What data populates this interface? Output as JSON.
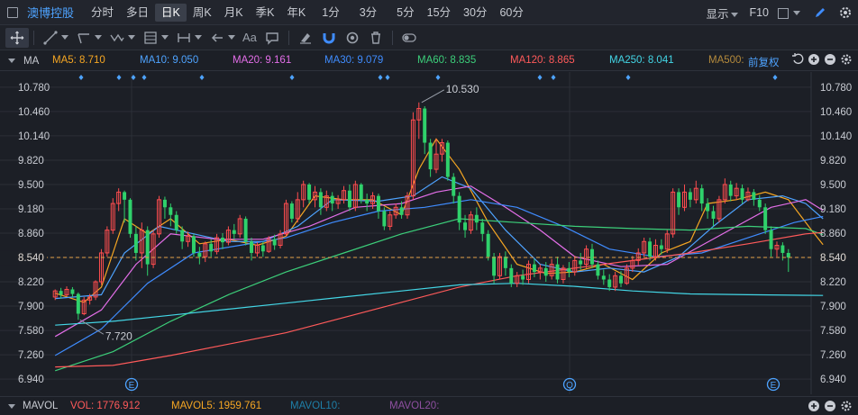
{
  "header": {
    "stock_name": "澳博控股",
    "periods": [
      "分时",
      "多日",
      "日K",
      "周K",
      "月K",
      "季K",
      "年K",
      "1分",
      "3分",
      "5分",
      "15分",
      "30分",
      "60分"
    ],
    "active_period": "日K",
    "display_label": "显示",
    "f10_label": "F10"
  },
  "toolbar": {
    "text_tool_label": "Aa"
  },
  "ma_line": {
    "title": "MA",
    "items": [
      {
        "label": "MA5: 8.710",
        "color": "#f5a623"
      },
      {
        "label": "MA10: 9.050",
        "color": "#4ea3ff"
      },
      {
        "label": "MA20: 9.161",
        "color": "#e36ee8"
      },
      {
        "label": "MA30: 9.079",
        "color": "#3f8cff"
      },
      {
        "label": "MA60: 8.835",
        "color": "#3ccf7a"
      },
      {
        "label": "MA120: 8.865",
        "color": "#ff5a5a"
      },
      {
        "label": "MA250: 8.041",
        "color": "#43d6e6"
      },
      {
        "label": "MA500:",
        "color": "#b48a3c"
      }
    ],
    "adjust_label": "前复权"
  },
  "volume_line": {
    "title": "MAVOL",
    "items": [
      {
        "label": "VOL: 1776.912",
        "color": "#ff5a5a"
      },
      {
        "label": "MAVOL5: 1959.761",
        "color": "#f5a623"
      },
      {
        "label": "MAVOL10:",
        "color": "#1e7fa8"
      },
      {
        "label": "MAVOL20:",
        "color": "#8e4fa0"
      }
    ]
  },
  "chart_data": {
    "type": "candlestick",
    "y_ticks": [
      "10.780",
      "10.460",
      "10.140",
      "9.820",
      "9.500",
      "9.180",
      "8.860",
      "8.540",
      "8.220",
      "7.900",
      "7.580",
      "7.260",
      "6.940"
    ],
    "y_range": [
      6.74,
      10.98
    ],
    "current_price": "8.540",
    "high_label": "10.530",
    "low_label": "7.720",
    "event_markers": [
      "E",
      "Q",
      "E"
    ],
    "colors": {
      "up": "#ff4d4f",
      "down": "#2fd16b",
      "grid": "#2b2f37",
      "axis_text": "#c9ccd3",
      "price_line": "#e3a04b"
    },
    "candles": [
      [
        8.02,
        8.1,
        8.12,
        7.98
      ],
      [
        8.1,
        8.05,
        8.14,
        8.0
      ],
      [
        8.05,
        8.12,
        8.16,
        8.03
      ],
      [
        8.12,
        8.06,
        8.15,
        8.02
      ],
      [
        8.06,
        7.8,
        8.08,
        7.72
      ],
      [
        7.8,
        7.98,
        8.02,
        7.78
      ],
      [
        7.98,
        8.02,
        8.06,
        7.92
      ],
      [
        8.02,
        8.22,
        8.24,
        7.98
      ],
      [
        8.22,
        8.6,
        8.65,
        8.18
      ],
      [
        8.6,
        8.9,
        8.95,
        8.55
      ],
      [
        8.9,
        9.25,
        9.32,
        8.85
      ],
      [
        9.25,
        9.4,
        9.45,
        9.15
      ],
      [
        9.4,
        9.3,
        9.42,
        9.0
      ],
      [
        9.3,
        8.85,
        9.32,
        8.8
      ],
      [
        8.85,
        8.6,
        8.95,
        8.5
      ],
      [
        8.6,
        8.9,
        9.0,
        8.4
      ],
      [
        8.9,
        8.45,
        8.95,
        8.3
      ],
      [
        8.45,
        8.85,
        8.9,
        8.4
      ],
      [
        8.85,
        9.3,
        9.35,
        8.8
      ],
      [
        9.3,
        9.2,
        9.34,
        9.05
      ],
      [
        9.2,
        9.1,
        9.25,
        8.95
      ],
      [
        9.1,
        8.9,
        9.15,
        8.85
      ],
      [
        8.9,
        8.75,
        8.95,
        8.65
      ],
      [
        8.75,
        8.82,
        8.88,
        8.68
      ],
      [
        8.82,
        8.6,
        8.85,
        8.55
      ],
      [
        8.6,
        8.55,
        8.68,
        8.45
      ],
      [
        8.55,
        8.72,
        8.75,
        8.48
      ],
      [
        8.72,
        8.62,
        8.78,
        8.55
      ],
      [
        8.62,
        8.8,
        8.85,
        8.58
      ],
      [
        8.8,
        8.74,
        8.86,
        8.65
      ],
      [
        8.74,
        8.9,
        8.95,
        8.7
      ],
      [
        8.9,
        8.85,
        8.98,
        8.78
      ],
      [
        8.85,
        9.05,
        9.1,
        8.8
      ],
      [
        9.05,
        8.75,
        9.08,
        8.7
      ],
      [
        8.75,
        8.6,
        8.8,
        8.5
      ],
      [
        8.6,
        8.7,
        8.74,
        8.55
      ],
      [
        8.7,
        8.62,
        8.75,
        8.55
      ],
      [
        8.62,
        8.78,
        8.82,
        8.6
      ],
      [
        8.78,
        8.7,
        8.84,
        8.64
      ],
      [
        8.7,
        8.85,
        8.9,
        8.66
      ],
      [
        8.85,
        9.25,
        9.3,
        8.82
      ],
      [
        9.25,
        9.05,
        9.28,
        9.0
      ],
      [
        9.05,
        9.3,
        9.4,
        9.0
      ],
      [
        9.3,
        9.5,
        9.55,
        9.2
      ],
      [
        9.5,
        9.3,
        9.52,
        9.25
      ],
      [
        9.3,
        9.4,
        9.48,
        9.2
      ],
      [
        9.4,
        9.2,
        9.45,
        9.1
      ],
      [
        9.2,
        9.35,
        9.42,
        9.15
      ],
      [
        9.35,
        9.25,
        9.4,
        9.15
      ],
      [
        9.25,
        9.3,
        9.36,
        9.18
      ],
      [
        9.3,
        9.42,
        9.48,
        9.25
      ],
      [
        9.42,
        9.2,
        9.5,
        9.15
      ],
      [
        9.2,
        9.5,
        9.55,
        9.15
      ],
      [
        9.5,
        9.3,
        9.52,
        9.25
      ],
      [
        9.3,
        9.25,
        9.38,
        9.15
      ],
      [
        9.25,
        9.35,
        9.4,
        9.18
      ],
      [
        9.35,
        9.15,
        9.38,
        9.05
      ],
      [
        9.15,
        8.95,
        9.2,
        8.9
      ],
      [
        8.95,
        9.1,
        9.15,
        8.9
      ],
      [
        9.1,
        9.2,
        9.25,
        9.05
      ],
      [
        9.2,
        9.1,
        9.28,
        9.05
      ],
      [
        9.1,
        9.35,
        9.4,
        9.05
      ],
      [
        9.35,
        10.35,
        10.45,
        9.3
      ],
      [
        10.35,
        10.5,
        10.58,
        10.1
      ],
      [
        10.5,
        10.05,
        10.53,
        9.9
      ],
      [
        10.05,
        9.7,
        10.1,
        9.6
      ],
      [
        9.7,
        9.9,
        10.1,
        9.65
      ],
      [
        9.9,
        10.05,
        10.1,
        9.8
      ],
      [
        10.05,
        9.6,
        10.08,
        9.55
      ],
      [
        9.6,
        9.35,
        9.65,
        9.25
      ],
      [
        9.35,
        9.0,
        9.4,
        8.9
      ],
      [
        9.0,
        8.9,
        9.1,
        8.8
      ],
      [
        8.9,
        9.1,
        9.15,
        8.85
      ],
      [
        9.1,
        9.0,
        9.2,
        8.9
      ],
      [
        9.0,
        8.85,
        9.05,
        8.75
      ],
      [
        8.85,
        8.55,
        8.9,
        8.5
      ],
      [
        8.55,
        8.3,
        8.6,
        8.2
      ],
      [
        8.3,
        8.55,
        8.6,
        8.25
      ],
      [
        8.55,
        8.4,
        8.62,
        8.3
      ],
      [
        8.4,
        8.2,
        8.45,
        8.15
      ],
      [
        8.2,
        8.3,
        8.35,
        8.15
      ],
      [
        8.3,
        8.25,
        8.38,
        8.18
      ],
      [
        8.25,
        8.45,
        8.5,
        8.2
      ],
      [
        8.45,
        8.35,
        8.52,
        8.28
      ],
      [
        8.35,
        8.4,
        8.45,
        8.25
      ],
      [
        8.4,
        8.3,
        8.48,
        8.22
      ],
      [
        8.3,
        8.45,
        8.52,
        8.25
      ],
      [
        8.45,
        8.25,
        8.55,
        8.2
      ],
      [
        8.25,
        8.4,
        8.44,
        8.2
      ],
      [
        8.4,
        8.35,
        8.48,
        8.28
      ],
      [
        8.35,
        8.5,
        8.56,
        8.3
      ],
      [
        8.5,
        8.45,
        8.6,
        8.38
      ],
      [
        8.45,
        8.65,
        8.7,
        8.4
      ],
      [
        8.65,
        8.45,
        8.72,
        8.4
      ],
      [
        8.45,
        8.3,
        8.5,
        8.25
      ],
      [
        8.3,
        8.25,
        8.38,
        8.18
      ],
      [
        8.25,
        8.15,
        8.32,
        8.1
      ],
      [
        8.15,
        8.3,
        8.35,
        8.1
      ],
      [
        8.3,
        8.2,
        8.36,
        8.15
      ],
      [
        8.2,
        8.4,
        8.45,
        8.18
      ],
      [
        8.4,
        8.5,
        8.56,
        8.35
      ],
      [
        8.5,
        8.6,
        8.66,
        8.44
      ],
      [
        8.6,
        8.75,
        8.8,
        8.55
      ],
      [
        8.75,
        8.55,
        8.8,
        8.5
      ],
      [
        8.55,
        8.7,
        8.78,
        8.5
      ],
      [
        8.7,
        8.65,
        8.78,
        8.58
      ],
      [
        8.65,
        8.85,
        8.9,
        8.6
      ],
      [
        8.85,
        9.4,
        9.45,
        8.8
      ],
      [
        9.4,
        9.2,
        9.45,
        9.1
      ],
      [
        9.2,
        9.4,
        9.5,
        9.15
      ],
      [
        9.4,
        9.3,
        9.45,
        9.2
      ],
      [
        9.3,
        9.45,
        9.55,
        9.25
      ],
      [
        9.45,
        9.25,
        9.5,
        9.15
      ],
      [
        9.25,
        9.15,
        9.32,
        9.05
      ],
      [
        9.15,
        9.05,
        9.22,
        8.95
      ],
      [
        9.05,
        9.3,
        9.35,
        9.0
      ],
      [
        9.3,
        9.5,
        9.58,
        9.25
      ],
      [
        9.5,
        9.35,
        9.55,
        9.28
      ],
      [
        9.35,
        9.45,
        9.52,
        9.3
      ],
      [
        9.45,
        9.3,
        9.5,
        9.25
      ],
      [
        9.3,
        9.4,
        9.46,
        9.28
      ],
      [
        9.4,
        9.3,
        9.44,
        9.22
      ],
      [
        9.3,
        9.2,
        9.36,
        9.15
      ],
      [
        9.2,
        8.9,
        9.25,
        8.85
      ],
      [
        8.9,
        8.65,
        8.95,
        8.55
      ],
      [
        8.65,
        8.7,
        8.75,
        8.55
      ],
      [
        8.7,
        8.6,
        8.74,
        8.5
      ],
      [
        8.6,
        8.54,
        8.65,
        8.35
      ]
    ],
    "ma_series": [
      {
        "color": "#f5a623",
        "points": [
          [
            0,
            8.07
          ],
          [
            5,
            7.95
          ],
          [
            8,
            8.15
          ],
          [
            12,
            9.05
          ],
          [
            16,
            8.85
          ],
          [
            20,
            9.05
          ],
          [
            25,
            8.72
          ],
          [
            30,
            8.78
          ],
          [
            35,
            8.7
          ],
          [
            40,
            8.82
          ],
          [
            45,
            9.35
          ],
          [
            50,
            9.3
          ],
          [
            55,
            9.3
          ],
          [
            60,
            9.1
          ],
          [
            63,
            9.7
          ],
          [
            66,
            10.1
          ],
          [
            70,
            9.7
          ],
          [
            75,
            9.0
          ],
          [
            80,
            8.45
          ],
          [
            85,
            8.33
          ],
          [
            90,
            8.35
          ],
          [
            95,
            8.45
          ],
          [
            100,
            8.25
          ],
          [
            105,
            8.6
          ],
          [
            110,
            8.75
          ],
          [
            113,
            9.25
          ],
          [
            118,
            9.3
          ],
          [
            123,
            9.4
          ],
          [
            127,
            9.3
          ],
          [
            131,
            8.9
          ],
          [
            133,
            8.71
          ]
        ]
      },
      {
        "color": "#4ea3ff",
        "points": [
          [
            0,
            8.0
          ],
          [
            8,
            8.05
          ],
          [
            12,
            8.6
          ],
          [
            18,
            8.95
          ],
          [
            24,
            8.85
          ],
          [
            30,
            8.75
          ],
          [
            36,
            8.75
          ],
          [
            42,
            8.95
          ],
          [
            48,
            9.3
          ],
          [
            56,
            9.28
          ],
          [
            62,
            9.35
          ],
          [
            67,
            9.6
          ],
          [
            72,
            9.45
          ],
          [
            78,
            8.9
          ],
          [
            84,
            8.45
          ],
          [
            90,
            8.35
          ],
          [
            96,
            8.4
          ],
          [
            102,
            8.35
          ],
          [
            108,
            8.55
          ],
          [
            114,
            8.95
          ],
          [
            120,
            9.3
          ],
          [
            126,
            9.35
          ],
          [
            130,
            9.25
          ],
          [
            133,
            9.05
          ]
        ]
      },
      {
        "color": "#e36ee8",
        "points": [
          [
            0,
            7.5
          ],
          [
            8,
            7.85
          ],
          [
            14,
            8.45
          ],
          [
            20,
            8.85
          ],
          [
            28,
            8.78
          ],
          [
            36,
            8.78
          ],
          [
            44,
            8.95
          ],
          [
            52,
            9.2
          ],
          [
            60,
            9.25
          ],
          [
            66,
            9.4
          ],
          [
            72,
            9.48
          ],
          [
            78,
            9.2
          ],
          [
            84,
            8.9
          ],
          [
            90,
            8.55
          ],
          [
            98,
            8.42
          ],
          [
            106,
            8.45
          ],
          [
            112,
            8.7
          ],
          [
            118,
            8.95
          ],
          [
            124,
            9.2
          ],
          [
            130,
            9.3
          ],
          [
            133,
            9.16
          ]
        ]
      },
      {
        "color": "#3f8cff",
        "points": [
          [
            0,
            7.25
          ],
          [
            8,
            7.6
          ],
          [
            16,
            8.2
          ],
          [
            24,
            8.6
          ],
          [
            32,
            8.7
          ],
          [
            40,
            8.8
          ],
          [
            48,
            9.0
          ],
          [
            56,
            9.15
          ],
          [
            64,
            9.2
          ],
          [
            72,
            9.3
          ],
          [
            80,
            9.2
          ],
          [
            88,
            8.95
          ],
          [
            96,
            8.65
          ],
          [
            104,
            8.55
          ],
          [
            112,
            8.6
          ],
          [
            120,
            8.8
          ],
          [
            128,
            9.0
          ],
          [
            133,
            9.08
          ]
        ]
      },
      {
        "color": "#3ccf7a",
        "points": [
          [
            0,
            7.05
          ],
          [
            10,
            7.3
          ],
          [
            20,
            7.7
          ],
          [
            30,
            8.05
          ],
          [
            40,
            8.35
          ],
          [
            50,
            8.6
          ],
          [
            60,
            8.85
          ],
          [
            70,
            9.05
          ],
          [
            80,
            9.0
          ],
          [
            90,
            8.95
          ],
          [
            100,
            8.92
          ],
          [
            110,
            8.9
          ],
          [
            120,
            8.95
          ],
          [
            130,
            8.92
          ],
          [
            133,
            8.84
          ]
        ]
      },
      {
        "color": "#ff5a5a",
        "points": [
          [
            0,
            7.1
          ],
          [
            10,
            7.12
          ],
          [
            20,
            7.25
          ],
          [
            30,
            7.4
          ],
          [
            40,
            7.55
          ],
          [
            50,
            7.75
          ],
          [
            60,
            7.95
          ],
          [
            70,
            8.15
          ],
          [
            80,
            8.3
          ],
          [
            90,
            8.4
          ],
          [
            100,
            8.5
          ],
          [
            110,
            8.6
          ],
          [
            120,
            8.72
          ],
          [
            130,
            8.85
          ],
          [
            133,
            8.87
          ]
        ]
      },
      {
        "color": "#43d6e6",
        "points": [
          [
            0,
            7.65
          ],
          [
            10,
            7.7
          ],
          [
            20,
            7.78
          ],
          [
            30,
            7.86
          ],
          [
            40,
            7.94
          ],
          [
            50,
            8.02
          ],
          [
            60,
            8.1
          ],
          [
            70,
            8.18
          ],
          [
            80,
            8.2
          ],
          [
            90,
            8.16
          ],
          [
            100,
            8.1
          ],
          [
            110,
            8.06
          ],
          [
            120,
            8.05
          ],
          [
            133,
            8.04
          ]
        ]
      }
    ]
  }
}
